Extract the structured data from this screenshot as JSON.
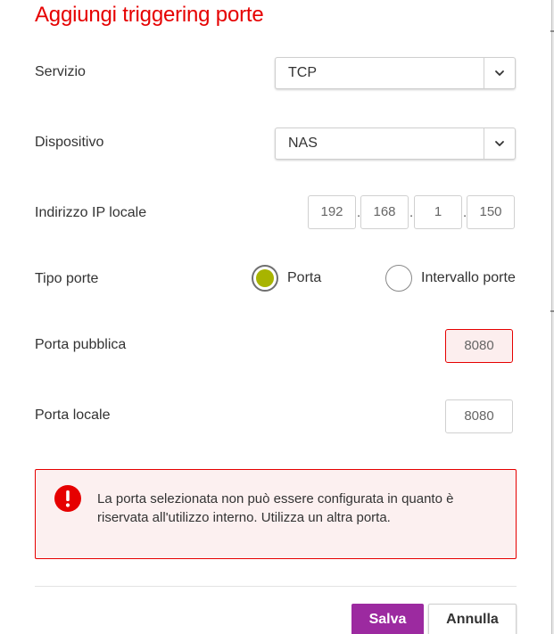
{
  "title": "Aggiungi triggering porte",
  "form": {
    "service": {
      "label": "Servizio",
      "value": "TCP",
      "icon": "chevron-down-icon"
    },
    "device": {
      "label": "Dispositivo",
      "value": "NAS",
      "icon": "chevron-down-icon"
    },
    "local_ip": {
      "label": "Indirizzo IP locale",
      "octets": [
        "192",
        "168",
        "1",
        "150"
      ],
      "separator": "."
    },
    "port_type": {
      "label": "Tipo porte",
      "options": [
        {
          "label": "Porta",
          "selected": true
        },
        {
          "label": "Intervallo porte",
          "selected": false
        }
      ],
      "selected_color": "#a8b400"
    },
    "public_port": {
      "label": "Porta pubblica",
      "value": "8080",
      "state": "error"
    },
    "local_port": {
      "label": "Porta locale",
      "value": "8080"
    }
  },
  "alert": {
    "icon": "exclamation-circle-icon",
    "message": "La porta selezionata non può essere configurata in quanto è riservata all'utilizzo interno. Utilizza un altra porta.",
    "color": "#e60000"
  },
  "buttons": {
    "save_label": "Salva",
    "cancel_label": "Annulla",
    "save_color": "#9c2aa0"
  },
  "colors": {
    "title": "#e60000",
    "error": "#e60000"
  }
}
